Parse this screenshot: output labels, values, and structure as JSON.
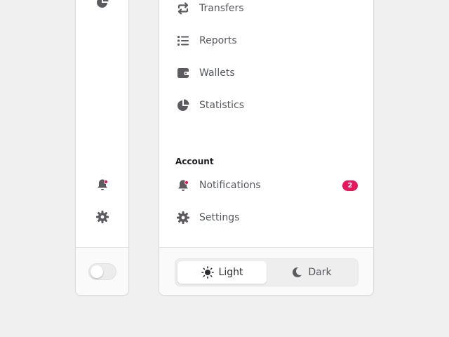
{
  "sidebar": {
    "items": [
      {
        "label": "Transfers",
        "icon": "transfer-icon"
      },
      {
        "label": "Reports",
        "icon": "list-icon"
      },
      {
        "label": "Wallets",
        "icon": "wallet-icon"
      },
      {
        "label": "Statistics",
        "icon": "pie-chart-icon"
      }
    ],
    "account_section": {
      "title": "Account",
      "items": [
        {
          "label": "Notifications",
          "icon": "bell-icon",
          "badge": "2"
        },
        {
          "label": "Settings",
          "icon": "gear-icon"
        }
      ]
    }
  },
  "theme_switcher": {
    "options": [
      {
        "label": "Light",
        "icon": "sun-icon",
        "selected": true
      },
      {
        "label": "Dark",
        "icon": "moon-icon",
        "selected": false
      }
    ]
  },
  "collapsed_sidebar": {
    "icons": [
      "pie-chart-icon",
      "bell-icon",
      "gear-icon"
    ],
    "theme_toggle_on": false
  },
  "colors": {
    "icon": "#5d5a5f",
    "accent": "#e8175d",
    "background": "#f0f0f0",
    "panel": "#ffffff"
  }
}
